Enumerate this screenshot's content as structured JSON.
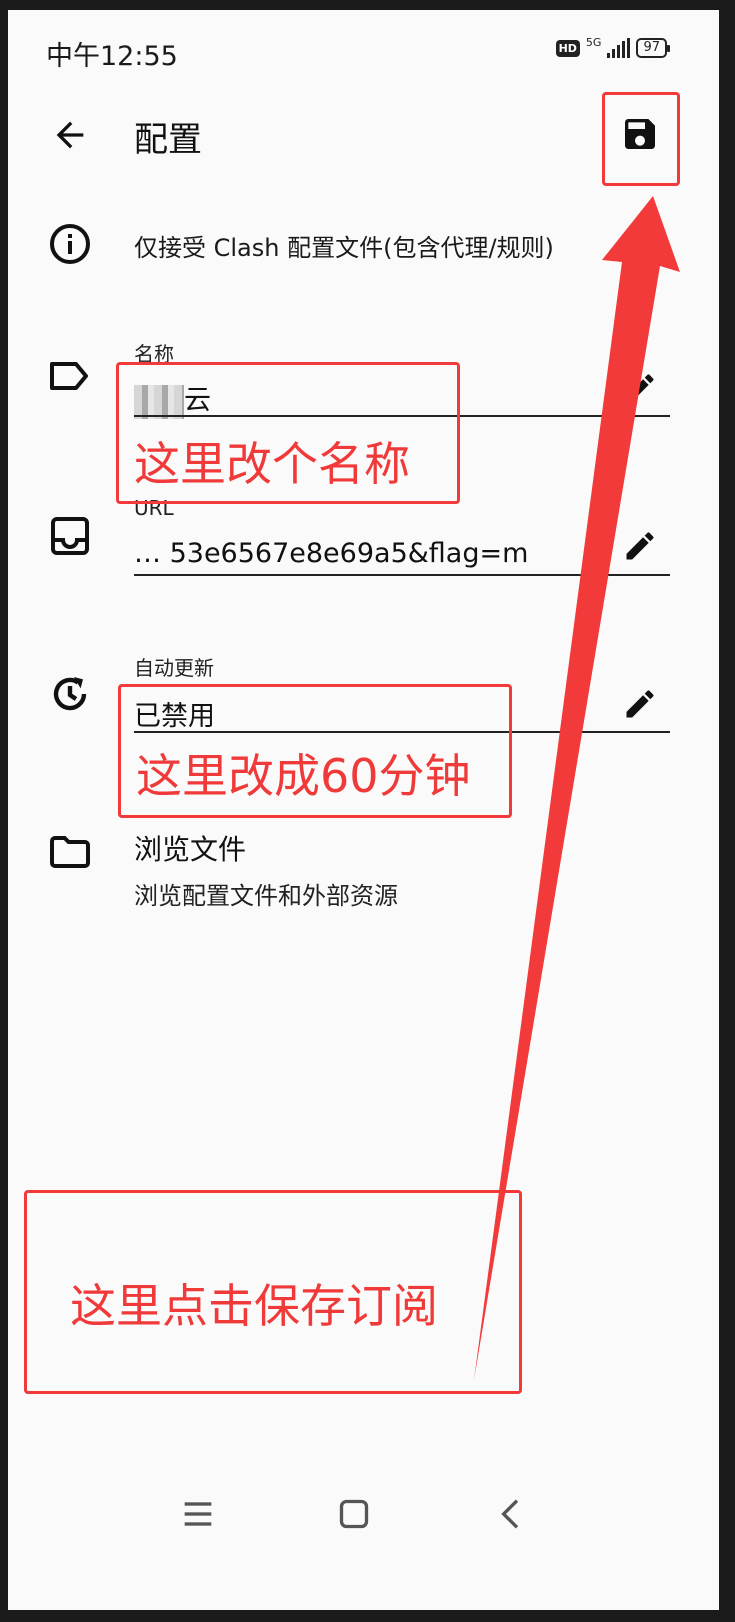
{
  "status_bar": {
    "time": "中午12:55",
    "hd": "HD",
    "network": "5G",
    "battery": "97"
  },
  "app_bar": {
    "title": "配置",
    "back_icon": "arrow-left-icon",
    "save_icon": "floppy-disk-icon"
  },
  "info": {
    "text": "仅接受 Clash 配置文件(包含代理/规则)",
    "icon": "info-icon"
  },
  "fields": {
    "name": {
      "label": "名称",
      "value": "云",
      "icon": "label-tag-icon",
      "edit_icon": "pencil-icon"
    },
    "url": {
      "label": "URL",
      "value": "…    53e6567e8e69a5&flag=m",
      "icon": "inbox-icon",
      "edit_icon": "pencil-icon"
    },
    "auto_update": {
      "label": "自动更新",
      "value": "已禁用",
      "icon": "clock-refresh-icon",
      "edit_icon": "pencil-icon"
    }
  },
  "browse": {
    "title": "浏览文件",
    "subtitle": "浏览配置文件和外部资源",
    "icon": "folder-icon"
  },
  "annotations": {
    "name_hint": "这里改个名称",
    "update_hint": "这里改成60分钟",
    "save_hint": "这里点击保存订阅",
    "color": "#f23a3a"
  },
  "nav_bar": {
    "menu_icon": "menu-lines-icon",
    "home_icon": "square-home-icon",
    "back_icon": "chevron-left-icon"
  }
}
